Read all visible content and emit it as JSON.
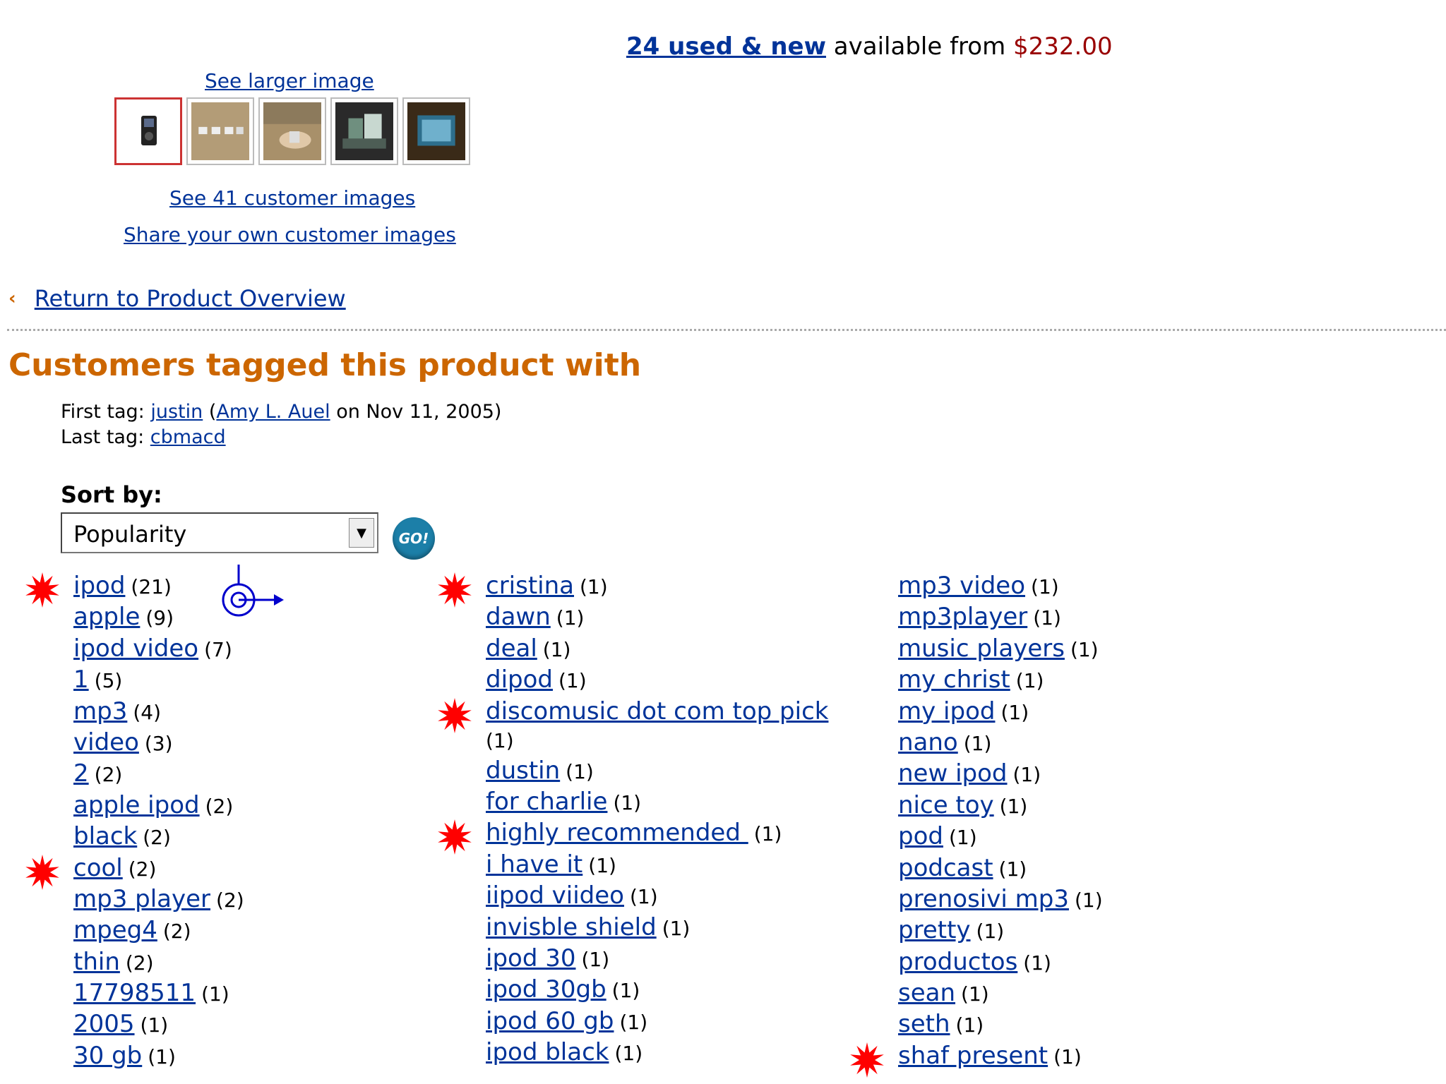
{
  "offer": {
    "used_new": "24 used & new",
    "available_from": " available from ",
    "price": "$232.00"
  },
  "images": {
    "see_larger": "See larger image",
    "see_customer": "See 41 customer images",
    "share_own": "Share your own customer images",
    "thumbs": [
      "ipod-thumbnail",
      "accessories-thumbnail",
      "hand-holding-ipod-thumbnail",
      "ipod-boxes-thumbnail",
      "ipod-screen-thumbnail"
    ]
  },
  "return_link": "Return to Product Overview",
  "tags_heading": "Customers tagged this product with",
  "tag_info": {
    "first_label": "First tag: ",
    "first_tag": "justin",
    "first_open": " (",
    "first_user": "Amy L. Auel",
    "first_date": " on Nov 11, 2005)",
    "last_label": "Last tag: ",
    "last_tag": "cbmacd"
  },
  "sort": {
    "label": "Sort by:",
    "selected": "Popularity",
    "go_label": "GO!"
  },
  "tags": {
    "col1": [
      {
        "name": "ipod",
        "count": "(21)",
        "starred": true
      },
      {
        "name": "apple",
        "count": "(9)",
        "starred": false
      },
      {
        "name": "ipod video",
        "count": "(7)",
        "starred": false
      },
      {
        "name": "1",
        "count": "(5)",
        "starred": false
      },
      {
        "name": "mp3",
        "count": "(4)",
        "starred": false
      },
      {
        "name": "video",
        "count": "(3)",
        "starred": false
      },
      {
        "name": "2",
        "count": "(2)",
        "starred": false
      },
      {
        "name": "apple ipod",
        "count": "(2)",
        "starred": false
      },
      {
        "name": "black",
        "count": "(2)",
        "starred": false
      },
      {
        "name": "cool",
        "count": "(2)",
        "starred": true
      },
      {
        "name": "mp3 player",
        "count": "(2)",
        "starred": false
      },
      {
        "name": "mpeg4",
        "count": "(2)",
        "starred": false
      },
      {
        "name": "thin",
        "count": "(2)",
        "starred": false
      },
      {
        "name": "17798511",
        "count": "(1)",
        "starred": false
      },
      {
        "name": "2005",
        "count": "(1)",
        "starred": false
      },
      {
        "name": "30 gb",
        "count": "(1)",
        "starred": false
      }
    ],
    "col2": [
      {
        "name": "cristina",
        "count": "(1)",
        "starred": true
      },
      {
        "name": "dawn",
        "count": "(1)",
        "starred": false
      },
      {
        "name": "deal",
        "count": "(1)",
        "starred": false
      },
      {
        "name": "dipod",
        "count": "(1)",
        "starred": false
      },
      {
        "name": "discomusic dot com top pick",
        "count": "(1)",
        "starred": true,
        "wrap": true
      },
      {
        "name": "dustin",
        "count": "(1)",
        "starred": false
      },
      {
        "name": "for charlie",
        "count": "(1)",
        "starred": false
      },
      {
        "name": "highly recommended ",
        "count": "(1)",
        "starred": true
      },
      {
        "name": "i have it",
        "count": "(1)",
        "starred": false
      },
      {
        "name": "iipod viideo",
        "count": "(1)",
        "starred": false
      },
      {
        "name": "invisble shield",
        "count": "(1)",
        "starred": false
      },
      {
        "name": "ipod 30",
        "count": "(1)",
        "starred": false
      },
      {
        "name": "ipod 30gb",
        "count": "(1)",
        "starred": false
      },
      {
        "name": "ipod 60 gb",
        "count": "(1)",
        "starred": false
      },
      {
        "name": "ipod black",
        "count": "(1)",
        "starred": false
      }
    ],
    "col3": [
      {
        "name": "mp3 video",
        "count": "(1)",
        "starred": false
      },
      {
        "name": "mp3player",
        "count": "(1)",
        "starred": false
      },
      {
        "name": "music players",
        "count": "(1)",
        "starred": false
      },
      {
        "name": "my christ",
        "count": "(1)",
        "starred": false
      },
      {
        "name": "my ipod",
        "count": "(1)",
        "starred": false
      },
      {
        "name": "nano",
        "count": "(1)",
        "starred": false
      },
      {
        "name": "new ipod",
        "count": "(1)",
        "starred": false
      },
      {
        "name": "nice toy",
        "count": "(1)",
        "starred": false
      },
      {
        "name": "pod",
        "count": "(1)",
        "starred": false
      },
      {
        "name": "podcast",
        "count": "(1)",
        "starred": false
      },
      {
        "name": "prenosivi mp3",
        "count": "(1)",
        "starred": false
      },
      {
        "name": "pretty",
        "count": "(1)",
        "starred": false
      },
      {
        "name": "productos",
        "count": "(1)",
        "starred": false
      },
      {
        "name": "sean",
        "count": "(1)",
        "starred": false
      },
      {
        "name": "seth",
        "count": "(1)",
        "starred": false
      },
      {
        "name": "shaf present",
        "count": "(1)",
        "starred": true
      }
    ]
  },
  "colors": {
    "link": "#003399",
    "heading": "#cc6600",
    "price": "#990000",
    "star": "#ff0000",
    "go_button": "#1c7fa8",
    "cursor": "#0000cc"
  }
}
